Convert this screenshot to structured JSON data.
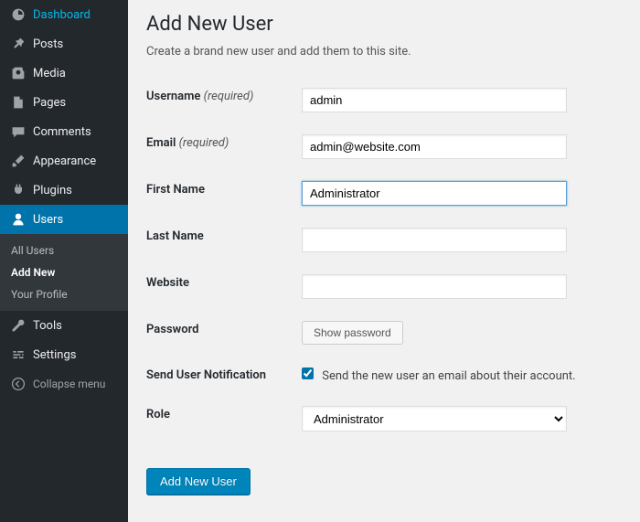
{
  "sidebar": {
    "items": [
      {
        "label": "Dashboard"
      },
      {
        "label": "Posts"
      },
      {
        "label": "Media"
      },
      {
        "label": "Pages"
      },
      {
        "label": "Comments"
      },
      {
        "label": "Appearance"
      },
      {
        "label": "Plugins"
      },
      {
        "label": "Users"
      },
      {
        "label": "Tools"
      },
      {
        "label": "Settings"
      }
    ],
    "submenu": [
      {
        "label": "All Users"
      },
      {
        "label": "Add New"
      },
      {
        "label": "Your Profile"
      }
    ],
    "collapse": "Collapse menu"
  },
  "page": {
    "title": "Add New User",
    "desc": "Create a brand new user and add them to this site."
  },
  "form": {
    "username": {
      "label": "Username",
      "req": "(required)",
      "value": "admin"
    },
    "email": {
      "label": "Email",
      "req": "(required)",
      "value": "admin@website.com"
    },
    "firstname": {
      "label": "First Name",
      "value": "Administrator"
    },
    "lastname": {
      "label": "Last Name",
      "value": ""
    },
    "website": {
      "label": "Website",
      "value": ""
    },
    "password": {
      "label": "Password",
      "button": "Show password"
    },
    "notification": {
      "label": "Send User Notification",
      "checkbox_label": "Send the new user an email about their account."
    },
    "role": {
      "label": "Role",
      "selected": "Administrator"
    },
    "submit": "Add New User"
  }
}
